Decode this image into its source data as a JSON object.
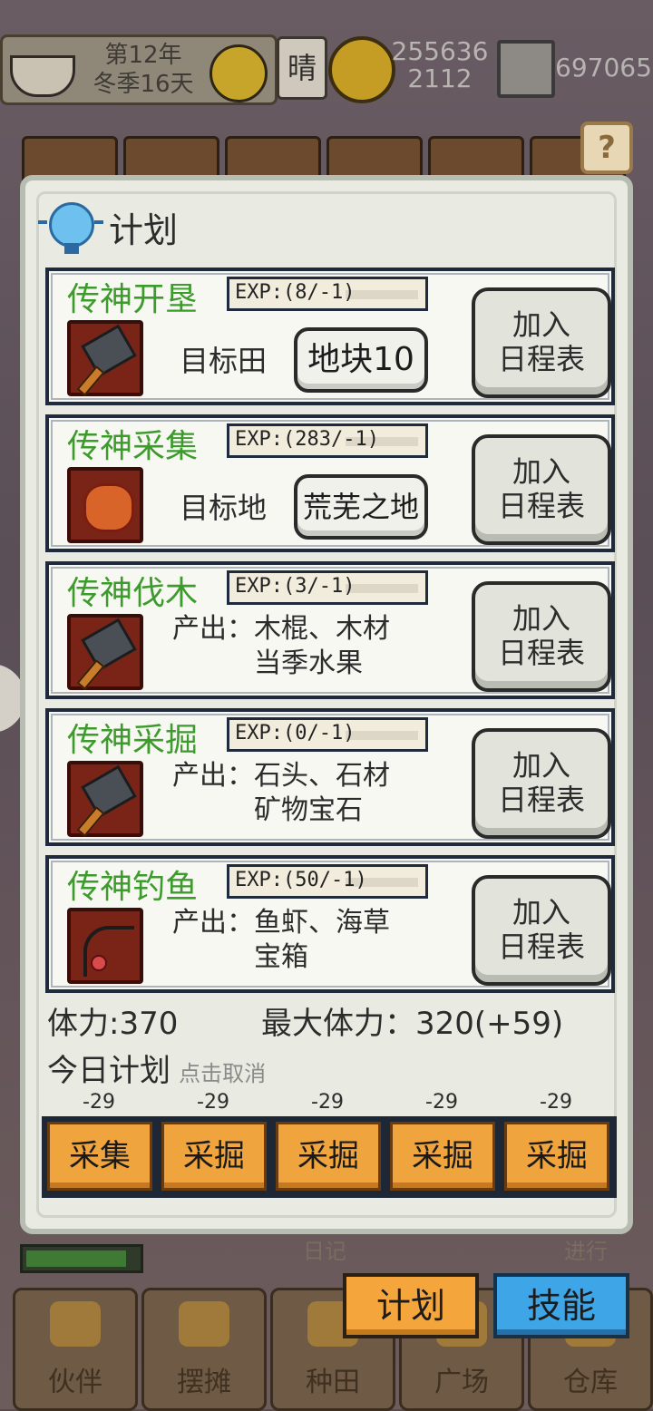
{
  "topbar": {
    "year": "第12年",
    "season_day": "冬季16天",
    "weather": "晴",
    "money_main": "255636",
    "money_sub": "2112",
    "gems": "697065"
  },
  "help_label": "?",
  "panel": {
    "title": "计划",
    "skills": [
      {
        "name": "传神开垦",
        "exp": "EXP:(8/-1)",
        "target_label": "目标田",
        "target_value": "地块10",
        "add_line1": "加入",
        "add_line2": "日程表"
      },
      {
        "name": "传神采集",
        "exp": "EXP:(283/-1)",
        "target_label": "目标地",
        "target_value": "荒芜之地",
        "add_line1": "加入",
        "add_line2": "日程表"
      },
      {
        "name": "传神伐木",
        "exp": "EXP:(3/-1)",
        "output_line1": "产出：木棍、木材",
        "output_line2": "当季水果",
        "add_line1": "加入",
        "add_line2": "日程表"
      },
      {
        "name": "传神采掘",
        "exp": "EXP:(0/-1)",
        "output_line1": "产出：石头、石材",
        "output_line2": "矿物宝石",
        "add_line1": "加入",
        "add_line2": "日程表"
      },
      {
        "name": "传神钓鱼",
        "exp": "EXP:(50/-1)",
        "output_line1": "产出：鱼虾、海草",
        "output_line2": "宝箱",
        "add_line1": "加入",
        "add_line2": "日程表"
      }
    ],
    "stamina": "体力:370",
    "max_stamina": "最大体力：320(+59)",
    "plan_title": "今日计划",
    "plan_hint": "点击取消",
    "plan_costs": [
      "-29",
      "-29",
      "-29",
      "-29",
      "-29"
    ],
    "plan_slots": [
      "采集",
      "采掘",
      "采掘",
      "采掘",
      "采掘"
    ]
  },
  "bottom": {
    "bg_labels": {
      "diary": "日记",
      "progress": "进行"
    },
    "tab_plan": "计划",
    "tab_skill": "技能",
    "nav": [
      "伙伴",
      "摆摊",
      "种田",
      "广场",
      "仓库"
    ]
  },
  "colors": {
    "skill_name": "#3d9a2c",
    "slot_orange": "#f0a43e",
    "tab_blue": "#3ea5e6",
    "panel_bg": "#e9ebe2"
  }
}
